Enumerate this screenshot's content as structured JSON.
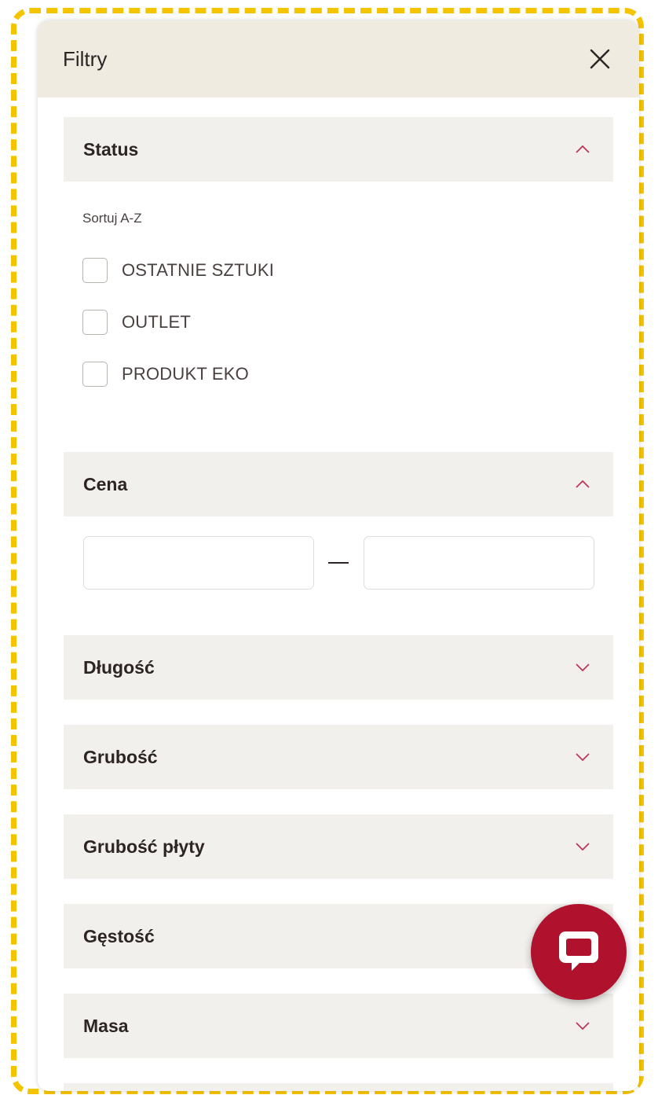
{
  "panel": {
    "title": "Filtry",
    "close_icon": "close-icon"
  },
  "sections": {
    "status": {
      "title": "Status",
      "expanded": true,
      "sort_label": "Sortuj A-Z",
      "options": [
        {
          "label": "OSTATNIE SZTUKI",
          "checked": false
        },
        {
          "label": "OUTLET",
          "checked": false
        },
        {
          "label": "PRODUKT EKO",
          "checked": false
        }
      ]
    },
    "price": {
      "title": "Cena",
      "expanded": true,
      "min_value": "",
      "max_value": "",
      "separator": "—"
    },
    "collapsed": [
      {
        "title": "Długość",
        "expanded": false
      },
      {
        "title": "Grubość",
        "expanded": false
      },
      {
        "title": "Grubość płyty",
        "expanded": false
      },
      {
        "title": "Gęstość",
        "expanded": false
      },
      {
        "title": "Masa",
        "expanded": false
      }
    ]
  },
  "chat": {
    "icon": "chat-bubble-icon"
  },
  "colors": {
    "header_bg": "#efebe1",
    "section_bg": "#f2f0ed",
    "accent": "#b0112c",
    "chevron": "#c0375a",
    "frame": "#f5c400"
  }
}
